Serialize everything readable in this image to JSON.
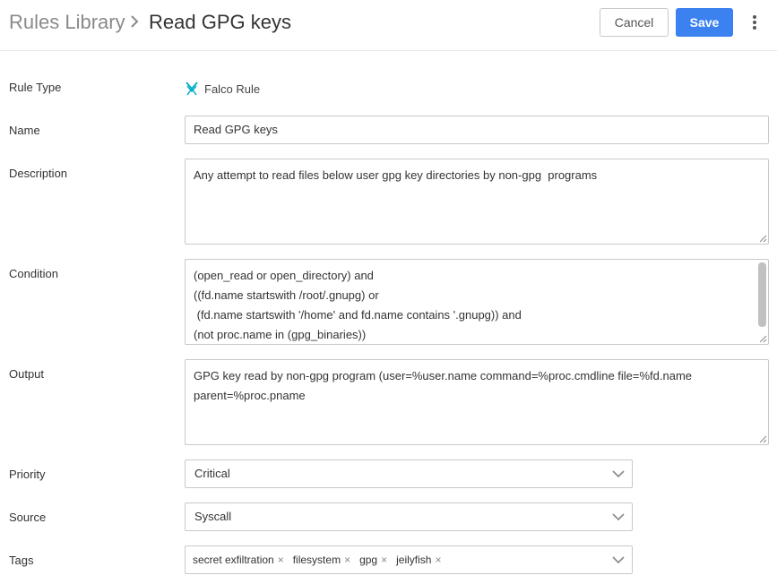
{
  "header": {
    "breadcrumb": "Rules Library",
    "title": "Read GPG keys",
    "cancel_label": "Cancel",
    "save_label": "Save"
  },
  "form": {
    "rule_type": {
      "label": "Rule Type",
      "value": "Falco Rule",
      "icon": "falco-icon"
    },
    "name": {
      "label": "Name",
      "value": "Read GPG keys"
    },
    "description": {
      "label": "Description",
      "value": "Any attempt to read files below user gpg key directories by non-gpg  programs"
    },
    "condition": {
      "label": "Condition",
      "lines": [
        "(open_read or open_directory) and",
        "((fd.name startswith /root/.gnupg) or",
        " (fd.name startswith '/home' and fd.name contains '.gnupg)) and",
        "(not proc.name in (gpg_binaries))"
      ]
    },
    "output": {
      "label": "Output",
      "lines": [
        "GPG key read by non-gpg program (user=%user.name command=%proc.cmdline file=%fd.name",
        "parent=%proc.pname"
      ]
    },
    "priority": {
      "label": "Priority",
      "value": "Critical"
    },
    "source": {
      "label": "Source",
      "value": "Syscall"
    },
    "tags": {
      "label": "Tags",
      "items": [
        "secret exfiltration",
        "filesystem",
        "gpg",
        "jeilyfish"
      ],
      "remove_glyph": "×"
    }
  },
  "colors": {
    "primary": "#3b82f0",
    "falco_icon": "#00aec7"
  }
}
